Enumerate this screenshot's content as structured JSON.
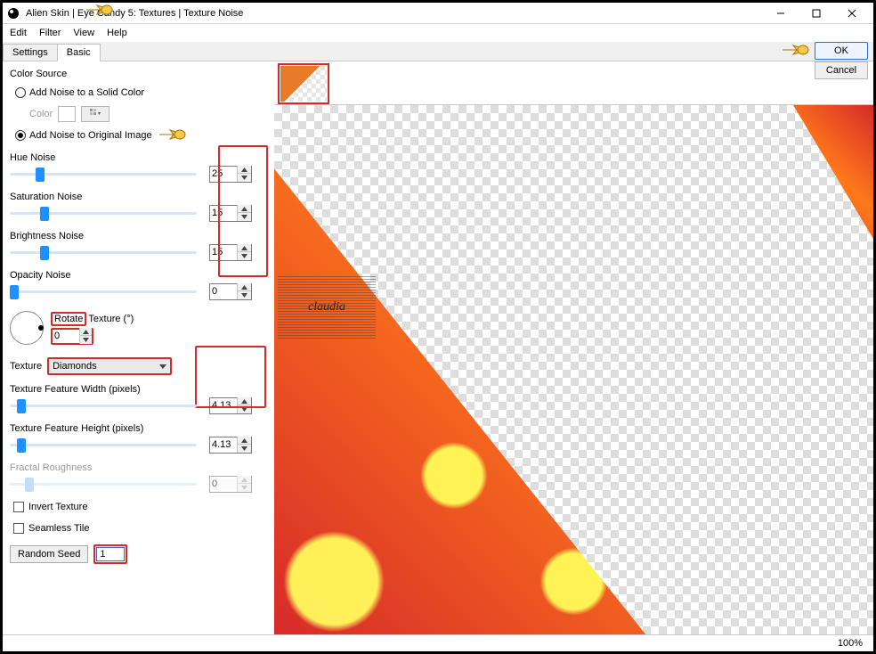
{
  "window": {
    "title": "Alien Skin | Eye Candy 5: Textures | Texture Noise"
  },
  "menu": {
    "edit": "Edit",
    "filter": "Filter",
    "view": "View",
    "help": "Help"
  },
  "tabs": {
    "settings": "Settings",
    "basic": "Basic"
  },
  "colorsource": {
    "title": "Color Source",
    "solid": "Add Noise to a Solid Color",
    "color_label": "Color",
    "original": "Add Noise to Original Image",
    "selected": "original"
  },
  "sliders": {
    "hue": {
      "label": "Hue Noise",
      "value": "25",
      "pos": 14
    },
    "sat": {
      "label": "Saturation Noise",
      "value": "15",
      "pos": 16
    },
    "bri": {
      "label": "Brightness Noise",
      "value": "15",
      "pos": 16
    },
    "opa": {
      "label": "Opacity Noise",
      "value": "0",
      "pos": 0
    }
  },
  "rotate": {
    "label": "Rotate",
    "suffix": "Texture (°)",
    "value": "0"
  },
  "texture": {
    "label": "Texture",
    "value": "Diamonds"
  },
  "featw": {
    "label": "Texture Feature Width (pixels)",
    "value": "4.13",
    "pos": 4
  },
  "feath": {
    "label": "Texture Feature Height (pixels)",
    "value": "4.13",
    "pos": 4
  },
  "fractal": {
    "label": "Fractal Roughness",
    "value": "0",
    "pos": 8
  },
  "invert": "Invert Texture",
  "seamless": "Seamless Tile",
  "seed": {
    "btn": "Random Seed",
    "value": "1"
  },
  "buttons": {
    "ok": "OK",
    "cancel": "Cancel"
  },
  "status": {
    "zoom": "100%"
  },
  "watermark": "claudia"
}
